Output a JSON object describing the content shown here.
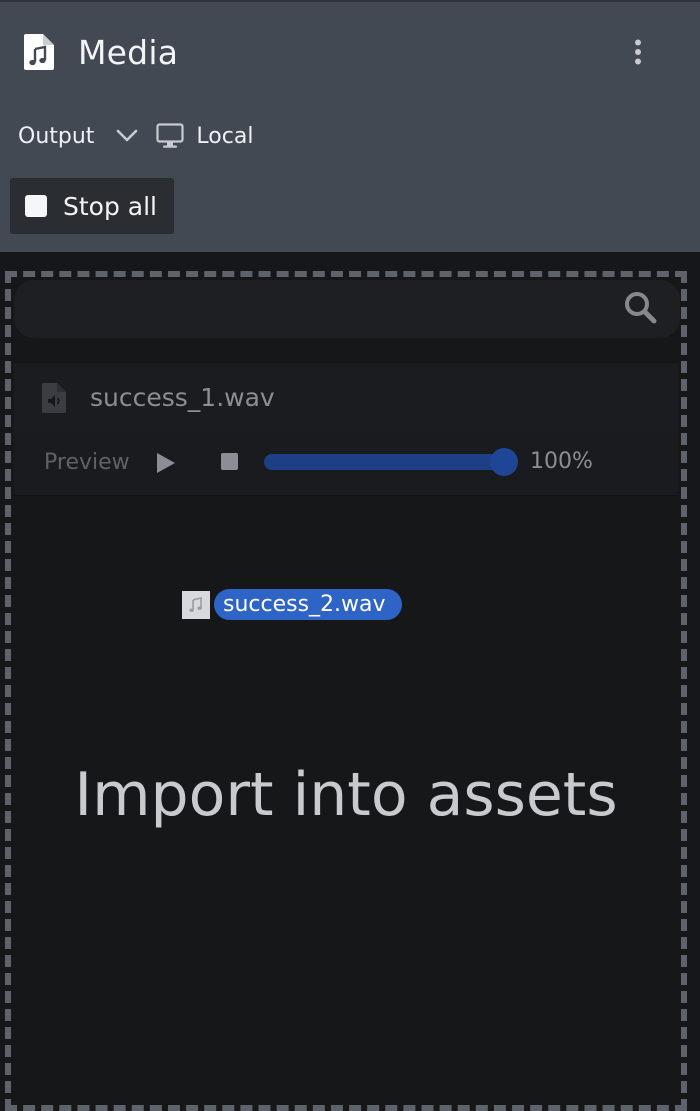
{
  "panel": {
    "title": "Media",
    "title_icon": "music-file-icon",
    "menu_icon": "more-vertical-icon"
  },
  "output": {
    "label": "Output",
    "dropdown_icon": "chevron-down-icon",
    "device_icon": "monitor-icon",
    "device_label": "Local"
  },
  "stop_all": {
    "icon": "stop-icon",
    "label": "Stop all"
  },
  "search": {
    "placeholder": "",
    "icon": "search-icon"
  },
  "files": [
    {
      "name": "success_1.wav",
      "icon": "audio-file-icon"
    }
  ],
  "preview": {
    "label": "Preview",
    "play_icon": "play-icon",
    "stop_icon": "stop-icon",
    "volume_fraction": 1.0,
    "volume_text": "100%"
  },
  "drag": {
    "icon": "music-note-icon",
    "file_name": "success_2.wav"
  },
  "dropzone": {
    "label": "Import into assets"
  },
  "colors": {
    "header_bg": "#434952",
    "panel_bg": "#16171a",
    "accent": "#2d64c6",
    "volume_fill": "#1d3f86"
  }
}
